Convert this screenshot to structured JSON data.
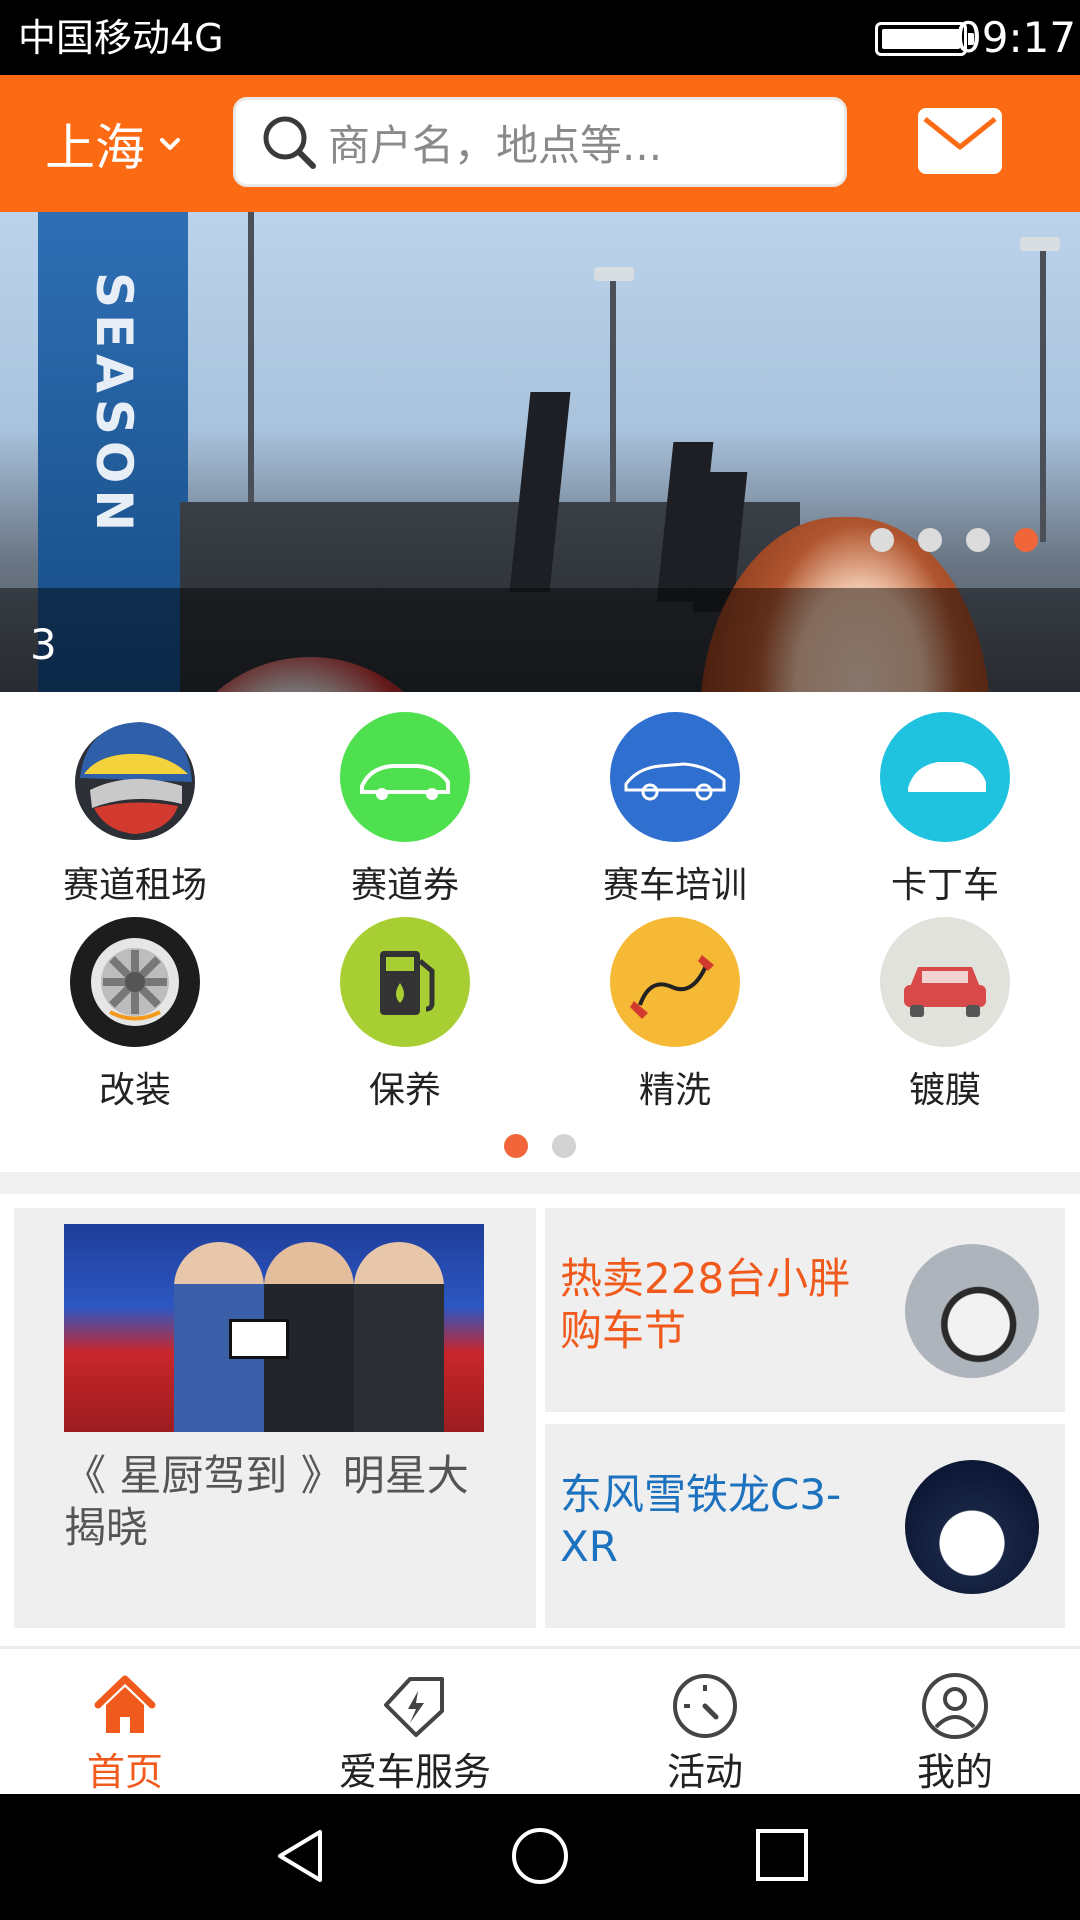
{
  "status_bar": {
    "carrier": "中国移动4G",
    "time": "09:17"
  },
  "header": {
    "city": "上海",
    "search_placeholder": "商户名，地点等..."
  },
  "banner": {
    "caption": "3",
    "dots": 4,
    "active_dot": 4
  },
  "services": [
    {
      "label": "赛道租场",
      "icon": "racing-helmet-icon",
      "color": "#2f5fa8"
    },
    {
      "label": "赛道券",
      "icon": "car-voucher-icon",
      "color": "#4fe04f"
    },
    {
      "label": "赛车培训",
      "icon": "car-outline-icon",
      "color": "#2f6fd0"
    },
    {
      "label": "卡丁车",
      "icon": "kart-car-icon",
      "color": "#1fc3e0"
    },
    {
      "label": "改装",
      "icon": "wheel-icon",
      "color": "#222222"
    },
    {
      "label": "保养",
      "icon": "fuel-pump-icon",
      "color": "#a7cf34"
    },
    {
      "label": "精洗",
      "icon": "jumper-cable-icon",
      "color": "#f6b936"
    },
    {
      "label": "镀膜",
      "icon": "red-car-icon",
      "color": "#e2e2dc"
    }
  ],
  "grid_pager": {
    "pages": 2,
    "active": 1
  },
  "promo": {
    "left_title": "《 星厨驾到 》明星大揭晓",
    "right_top": "热卖228台小胖购车节",
    "right_bottom": "东风雪铁龙C3-XR"
  },
  "bottom_nav": [
    {
      "label": "首页",
      "icon": "home-icon",
      "active": true
    },
    {
      "label": "爱车服务",
      "icon": "tag-bolt-icon",
      "active": false
    },
    {
      "label": "活动",
      "icon": "gauge-icon",
      "active": false
    },
    {
      "label": "我的",
      "icon": "user-icon",
      "active": false
    }
  ],
  "colors": {
    "brand": "#fd6a14",
    "accent_text": "#f15a1d",
    "link_blue": "#1c72bf"
  }
}
